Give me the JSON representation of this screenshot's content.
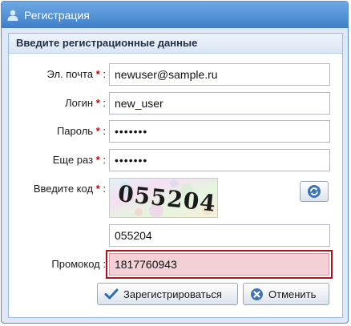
{
  "window": {
    "title": "Регистрация"
  },
  "panel": {
    "header": "Введите регистрационные данные"
  },
  "fields": {
    "email": {
      "label": "Эл. почта",
      "value": "newuser@sample.ru"
    },
    "login": {
      "label": "Логин",
      "value": "new_user"
    },
    "password": {
      "label": "Пароль",
      "value": "•••••••"
    },
    "password_repeat": {
      "label": "Еще раз",
      "value": "•••••••"
    },
    "captcha": {
      "label": "Введите код",
      "image_text": "055204",
      "value": "055204"
    },
    "promo": {
      "label": "Промокод",
      "value": "1817760943"
    }
  },
  "required_mark": "*",
  "label_suffix": ":",
  "buttons": {
    "register": "Зарегистрироваться",
    "cancel": "Отменить"
  },
  "colors": {
    "title_bar": "#4f8fd0",
    "required": "#cc0000",
    "promo_highlight_border": "#b0121d",
    "promo_background": "#f3cfd6"
  },
  "icons": {
    "title": "user-icon",
    "refresh": "refresh-icon",
    "register": "checkmark-icon",
    "cancel": "cancel-icon"
  }
}
